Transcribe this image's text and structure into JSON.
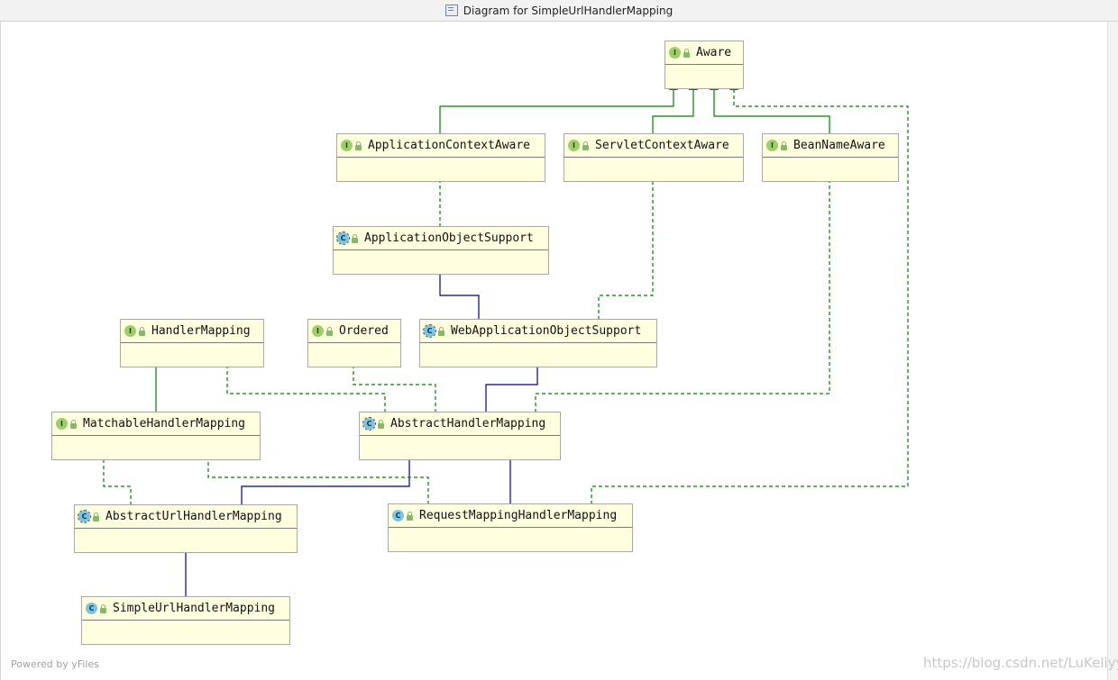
{
  "window": {
    "title": "Diagram for SimpleUrlHandlerMapping"
  },
  "footer": {
    "powered_by": "Powered by yFiles",
    "watermark": "https://blog.csdn.net/LuKeliyy"
  },
  "colors": {
    "node_fill": "#ffffe0",
    "interface_edge": "#008000",
    "extends_edge": "#000080"
  },
  "nodes": [
    {
      "id": "aware",
      "label": "Aware",
      "kind": "interface"
    },
    {
      "id": "aca",
      "label": "ApplicationContextAware",
      "kind": "interface"
    },
    {
      "id": "sca",
      "label": "ServletContextAware",
      "kind": "interface"
    },
    {
      "id": "bna",
      "label": "BeanNameAware",
      "kind": "interface"
    },
    {
      "id": "aos",
      "label": "ApplicationObjectSupport",
      "kind": "abstract-class"
    },
    {
      "id": "hm",
      "label": "HandlerMapping",
      "kind": "interface"
    },
    {
      "id": "ord",
      "label": "Ordered",
      "kind": "interface"
    },
    {
      "id": "waos",
      "label": "WebApplicationObjectSupport",
      "kind": "abstract-class"
    },
    {
      "id": "mhm",
      "label": "MatchableHandlerMapping",
      "kind": "interface"
    },
    {
      "id": "ahm",
      "label": "AbstractHandlerMapping",
      "kind": "abstract-class"
    },
    {
      "id": "auhm",
      "label": "AbstractUrlHandlerMapping",
      "kind": "abstract-class"
    },
    {
      "id": "rmhm",
      "label": "RequestMappingHandlerMapping",
      "kind": "class"
    },
    {
      "id": "suhm",
      "label": "SimpleUrlHandlerMapping",
      "kind": "class"
    }
  ],
  "edges": [
    {
      "from": "aca",
      "to": "aware",
      "type": "extends-interface"
    },
    {
      "from": "sca",
      "to": "aware",
      "type": "extends-interface"
    },
    {
      "from": "bna",
      "to": "aware",
      "type": "extends-interface"
    },
    {
      "from": "aos",
      "to": "aca",
      "type": "implements"
    },
    {
      "from": "waos",
      "to": "aos",
      "type": "extends-class"
    },
    {
      "from": "waos",
      "to": "sca",
      "type": "implements"
    },
    {
      "from": "mhm",
      "to": "hm",
      "type": "extends-interface"
    },
    {
      "from": "ahm",
      "to": "hm",
      "type": "implements"
    },
    {
      "from": "ahm",
      "to": "ord",
      "type": "implements"
    },
    {
      "from": "ahm",
      "to": "waos",
      "type": "extends-class"
    },
    {
      "from": "ahm",
      "to": "bna",
      "type": "implements"
    },
    {
      "from": "auhm",
      "to": "mhm",
      "type": "implements"
    },
    {
      "from": "auhm",
      "to": "ahm",
      "type": "extends-class"
    },
    {
      "from": "rmhm",
      "to": "mhm",
      "type": "implements"
    },
    {
      "from": "rmhm",
      "to": "ahm",
      "type": "extends-class"
    },
    {
      "from": "rmhm",
      "to": "aware",
      "type": "implements"
    },
    {
      "from": "suhm",
      "to": "auhm",
      "type": "extends-class"
    }
  ]
}
